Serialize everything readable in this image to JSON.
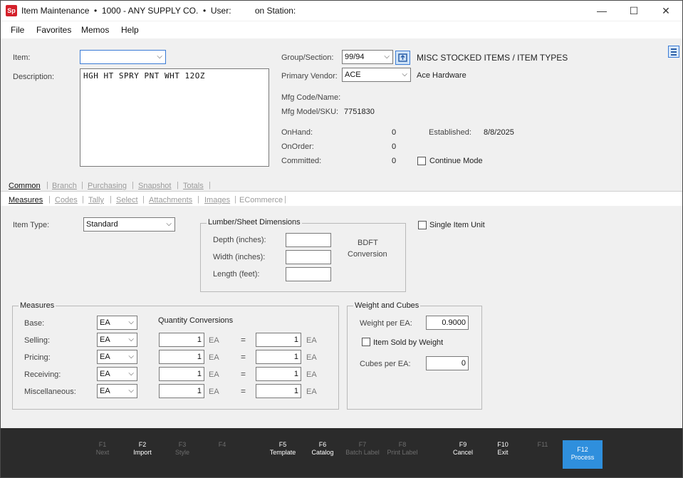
{
  "window": {
    "title": "Item Maintenance  •  1000 - ANY SUPPLY CO.  •  User:          on Station:",
    "logo": "Sp",
    "minimize": "—",
    "maximize": "☐",
    "close": "✕"
  },
  "menu": [
    "File",
    "Favorites",
    "Memos",
    "Help"
  ],
  "item": {
    "item_label": "Item:",
    "item_value": "",
    "description_label": "Description:",
    "description_value": "HGH HT SPRY PNT WHT 12OZ",
    "group_label": "Group/Section:",
    "group_value": "99/94",
    "group_desc": "MISC STOCKED ITEMS / ITEM TYPES",
    "vendor_label": "Primary Vendor:",
    "vendor_value": "ACE",
    "vendor_name": "Ace Hardware",
    "mfg_code_label": "Mfg Code/Name:",
    "mfg_model_label": "Mfg Model/SKU:",
    "mfg_model_value": "7751830",
    "onhand_label": "OnHand:",
    "onhand_value": "0",
    "onorder_label": "OnOrder:",
    "onorder_value": "0",
    "committed_label": "Committed:",
    "committed_value": "0",
    "established_label": "Established:",
    "established_value": "8/8/2025",
    "continue_mode_label": "Continue Mode"
  },
  "tabs_primary": [
    "Common",
    "Branch",
    "Purchasing",
    "Snapshot",
    "Totals"
  ],
  "tabs_secondary": [
    "Measures",
    "Codes",
    "Tally",
    "Select",
    "Attachments",
    "Images",
    "ECommerce"
  ],
  "measures_tab": {
    "item_type_label": "Item Type:",
    "item_type_value": "Standard",
    "lumber_title": "Lumber/Sheet Dimensions",
    "depth_label": "Depth (inches):",
    "width_label": "Width (inches):",
    "length_label": "Length (feet):",
    "bdft_line1": "BDFT",
    "bdft_line2": "Conversion",
    "single_item_unit_label": "Single Item Unit",
    "measures_title": "Measures",
    "quantity_conversions_label": "Quantity Conversions",
    "base_label": "Base:",
    "base_unit": "EA",
    "rows": [
      {
        "label": "Selling:",
        "unit": "EA",
        "qty1": "1",
        "u1": "EA",
        "eq": "=",
        "qty2": "1",
        "u2": "EA"
      },
      {
        "label": "Pricing:",
        "unit": "EA",
        "qty1": "1",
        "u1": "EA",
        "eq": "=",
        "qty2": "1",
        "u2": "EA"
      },
      {
        "label": "Receiving:",
        "unit": "EA",
        "qty1": "1",
        "u1": "EA",
        "eq": "=",
        "qty2": "1",
        "u2": "EA"
      },
      {
        "label": "Miscellaneous:",
        "unit": "EA",
        "qty1": "1",
        "u1": "EA",
        "eq": "=",
        "qty2": "1",
        "u2": "EA"
      }
    ],
    "weight_title": "Weight and Cubes",
    "weight_label": "Weight per EA:",
    "weight_value": "0.9000",
    "sold_by_weight_label": "Item Sold by Weight",
    "cubes_label": "Cubes per EA:",
    "cubes_value": "0"
  },
  "footer_keys": [
    {
      "key": "F1",
      "label": "Next",
      "enabled": false
    },
    {
      "key": "F2",
      "label": "Import",
      "enabled": true
    },
    {
      "key": "F3",
      "label": "Style",
      "enabled": false
    },
    {
      "key": "F4",
      "label": "",
      "enabled": false
    },
    {
      "key": "F5",
      "label": "Template",
      "enabled": true
    },
    {
      "key": "F6",
      "label": "Catalog",
      "enabled": true
    },
    {
      "key": "F7",
      "label": "Batch Label",
      "enabled": false
    },
    {
      "key": "F8",
      "label": "Print Label",
      "enabled": false
    },
    {
      "key": "F9",
      "label": "Cancel",
      "enabled": true
    },
    {
      "key": "F10",
      "label": "Exit",
      "enabled": true
    },
    {
      "key": "F11",
      "label": "",
      "enabled": false
    },
    {
      "key": "F12",
      "label": "Process",
      "enabled": true
    }
  ],
  "colors": {
    "accent": "#2f8fdd",
    "footer": "#2b2b2b",
    "logo": "#d4202a"
  }
}
